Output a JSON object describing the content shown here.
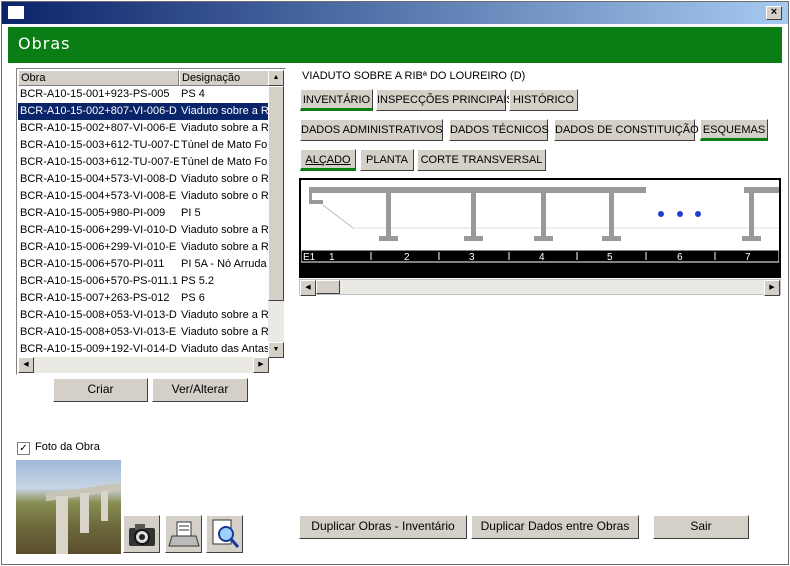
{
  "window": {
    "close_label": "×"
  },
  "header": {
    "title": "Obras"
  },
  "list": {
    "columns": [
      "Obra",
      "Designação"
    ],
    "rows": [
      [
        "BCR-A10-15-001+923-PS-005",
        "PS 4"
      ],
      [
        "BCR-A10-15-002+807-VI-006-D",
        "Viaduto sobre a Ri"
      ],
      [
        "BCR-A10-15-002+807-VI-006-E",
        "Viaduto sobre a Ri"
      ],
      [
        "BCR-A10-15-003+612-TU-007-D",
        "Túnel de Mato Fort"
      ],
      [
        "BCR-A10-15-003+612-TU-007-E",
        "Túnel de Mato Fort"
      ],
      [
        "BCR-A10-15-004+573-VI-008-D",
        "Viaduto sobre o Ri"
      ],
      [
        "BCR-A10-15-004+573-VI-008-E",
        "Viaduto sobre o Ri"
      ],
      [
        "BCR-A10-15-005+980-PI-009",
        "PI 5"
      ],
      [
        "BCR-A10-15-006+299-VI-010-D",
        "Viaduto sobre a Ri"
      ],
      [
        "BCR-A10-15-006+299-VI-010-E",
        "Viaduto sobre a Ri"
      ],
      [
        "BCR-A10-15-006+570-PI-011",
        "PI 5A - Nó Arruda"
      ],
      [
        "BCR-A10-15-006+570-PS-011.1",
        "PS 5.2"
      ],
      [
        "BCR-A10-15-007+263-PS-012",
        "PS 6"
      ],
      [
        "BCR-A10-15-008+053-VI-013-D",
        "Viaduto sobre a Ri"
      ],
      [
        "BCR-A10-15-008+053-VI-013-E",
        "Viaduto sobre a Ri"
      ],
      [
        "BCR-A10-15-009+192-VI-014-D",
        "Viaduto das Antas"
      ]
    ],
    "selected_index": 1
  },
  "buttons": {
    "criar": "Criar",
    "ver_alterar": "Ver/Alterar",
    "duplicar_inventario": "Duplicar Obras - Inventário",
    "duplicar_dados": "Duplicar Dados entre Obras",
    "sair": "Sair"
  },
  "foto": {
    "label": "Foto da Obra",
    "checked": true
  },
  "detail": {
    "title": "VIADUTO SOBRE A RIBª DO LOUREIRO (D)",
    "tabs1": [
      "INVENTÁRIO",
      "INSPECÇÕES PRINCIPAIS",
      "HISTÓRICO"
    ],
    "tabs2": [
      "DADOS ADMINISTRATIVOS",
      "DADOS TÉCNICOS",
      "DADOS DE CONSTITUIÇÃO",
      "ESQUEMAS"
    ],
    "tabs3": [
      "ALÇADO",
      "PLANTA",
      "CORTE TRANSVERSAL"
    ]
  },
  "scheme": {
    "labels": [
      "E1",
      "1",
      "2",
      "3",
      "4",
      "5",
      "6",
      "7"
    ]
  },
  "colors": {
    "header_green": "#0a7e14",
    "selection": "#0a246a",
    "dots": "#1f3fcf"
  }
}
